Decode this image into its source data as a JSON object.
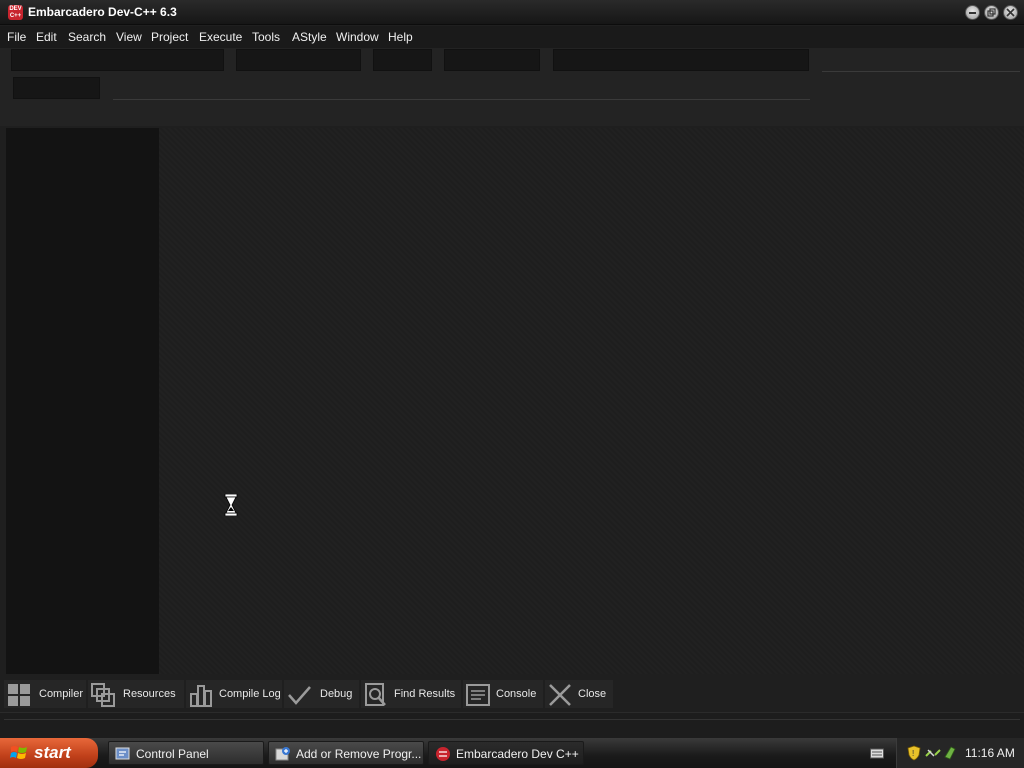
{
  "window": {
    "title": "Embarcadero Dev-C++ 6.3",
    "app_icon_text": "DEV C++"
  },
  "menu": {
    "items": [
      {
        "label": "File"
      },
      {
        "label": "Edit"
      },
      {
        "label": "Search"
      },
      {
        "label": "View"
      },
      {
        "label": "Project"
      },
      {
        "label": "Execute"
      },
      {
        "label": "Tools"
      },
      {
        "label": "AStyle"
      },
      {
        "label": "Window"
      },
      {
        "label": "Help"
      }
    ]
  },
  "bottom_tabs": [
    {
      "label": "Compiler",
      "icon": "grid-icon"
    },
    {
      "label": "Resources",
      "icon": "resources-icon"
    },
    {
      "label": "Compile Log",
      "icon": "bar-chart-icon"
    },
    {
      "label": "Debug",
      "icon": "checkmark-icon"
    },
    {
      "label": "Find Results",
      "icon": "magnifier-page-icon"
    },
    {
      "label": "Console",
      "icon": "console-icon"
    },
    {
      "label": "Close",
      "icon": "close-x-icon"
    }
  ],
  "taskbar": {
    "start_label": "start",
    "tasks": [
      {
        "label": "Control Panel",
        "icon": "control-panel-icon"
      },
      {
        "label": "Add or Remove Progr...",
        "icon": "add-remove-programs-icon"
      },
      {
        "label": "Embarcadero Dev C++",
        "icon": "devcpp-icon"
      }
    ],
    "clock": "11:16 AM"
  },
  "colors": {
    "background": "#1f1f1f",
    "start_button": "#d4532a",
    "app_icon": "#c8242e"
  }
}
